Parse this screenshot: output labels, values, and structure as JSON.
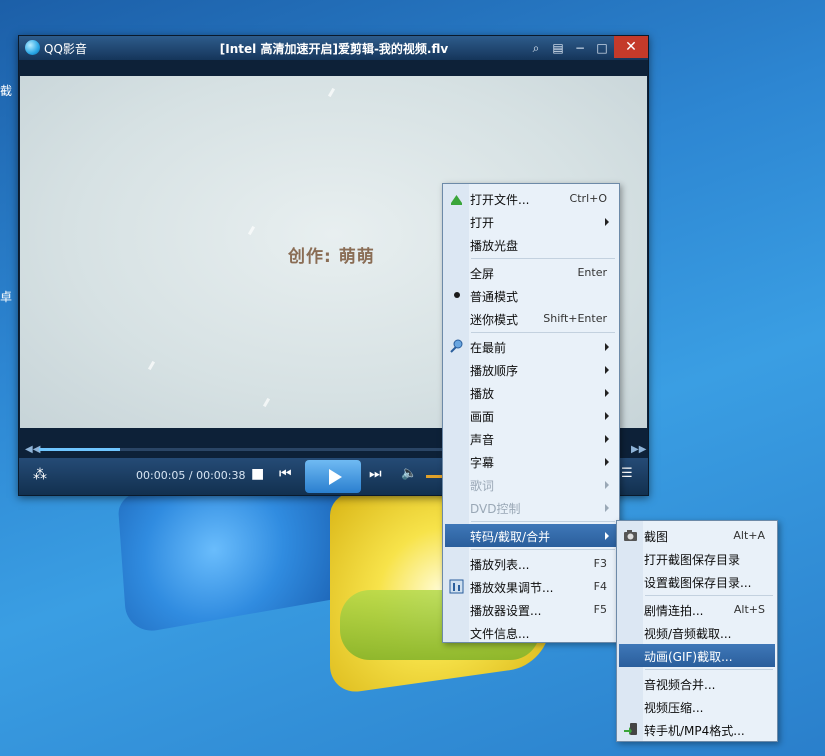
{
  "desktop": {
    "left_chars": [
      "截",
      "卓"
    ]
  },
  "player": {
    "app_name": "QQ影音",
    "title": "[Intel 高清加速开启]爱剪辑-我的视频.flv",
    "caption": "创作: 萌萌",
    "time": "00:00:05 / 00:00:38",
    "progress_fraction": 0.14,
    "close_label": "✕"
  },
  "main_menu": {
    "items": [
      {
        "label": "打开文件...",
        "shortcut": "Ctrl+O",
        "icon": "open-file-icon"
      },
      {
        "label": "打开",
        "submenu": true
      },
      {
        "label": "播放光盘"
      },
      {
        "separator": true
      },
      {
        "label": "全屏",
        "shortcut": "Enter"
      },
      {
        "label": "普通模式",
        "checked": true
      },
      {
        "label": "迷你模式",
        "shortcut": "Shift+Enter"
      },
      {
        "separator": true
      },
      {
        "label": "在最前",
        "submenu": true,
        "icon": "pin-icon"
      },
      {
        "label": "播放顺序",
        "submenu": true
      },
      {
        "label": "播放",
        "submenu": true
      },
      {
        "label": "画面",
        "submenu": true
      },
      {
        "label": "声音",
        "submenu": true
      },
      {
        "label": "字幕",
        "submenu": true
      },
      {
        "label": "歌词",
        "submenu": true,
        "disabled": true
      },
      {
        "label": "DVD控制",
        "submenu": true,
        "disabled": true
      },
      {
        "separator": true
      },
      {
        "label": "转码/截取/合并",
        "submenu": true,
        "highlighted": true
      },
      {
        "separator": true
      },
      {
        "label": "播放列表...",
        "shortcut": "F3"
      },
      {
        "label": "播放效果调节...",
        "shortcut": "F4",
        "icon": "effects-icon"
      },
      {
        "label": "播放器设置...",
        "shortcut": "F5"
      },
      {
        "label": "文件信息..."
      }
    ]
  },
  "sub_menu": {
    "items": [
      {
        "label": "截图",
        "shortcut": "Alt+A",
        "icon": "camera-icon"
      },
      {
        "label": "打开截图保存目录"
      },
      {
        "label": "设置截图保存目录..."
      },
      {
        "separator": true
      },
      {
        "label": "剧情连拍...",
        "shortcut": "Alt+S"
      },
      {
        "label": "视频/音频截取..."
      },
      {
        "label": "动画(GIF)截取...",
        "highlighted": true
      },
      {
        "separator": true
      },
      {
        "label": "音视频合并..."
      },
      {
        "label": "视频压缩..."
      },
      {
        "label": "转手机/MP4格式...",
        "icon": "phone-convert-icon"
      }
    ]
  },
  "colors": {
    "accent": "#2a5e9c",
    "close": "#c43a2a",
    "menu_bg": "#e9f1f9"
  }
}
